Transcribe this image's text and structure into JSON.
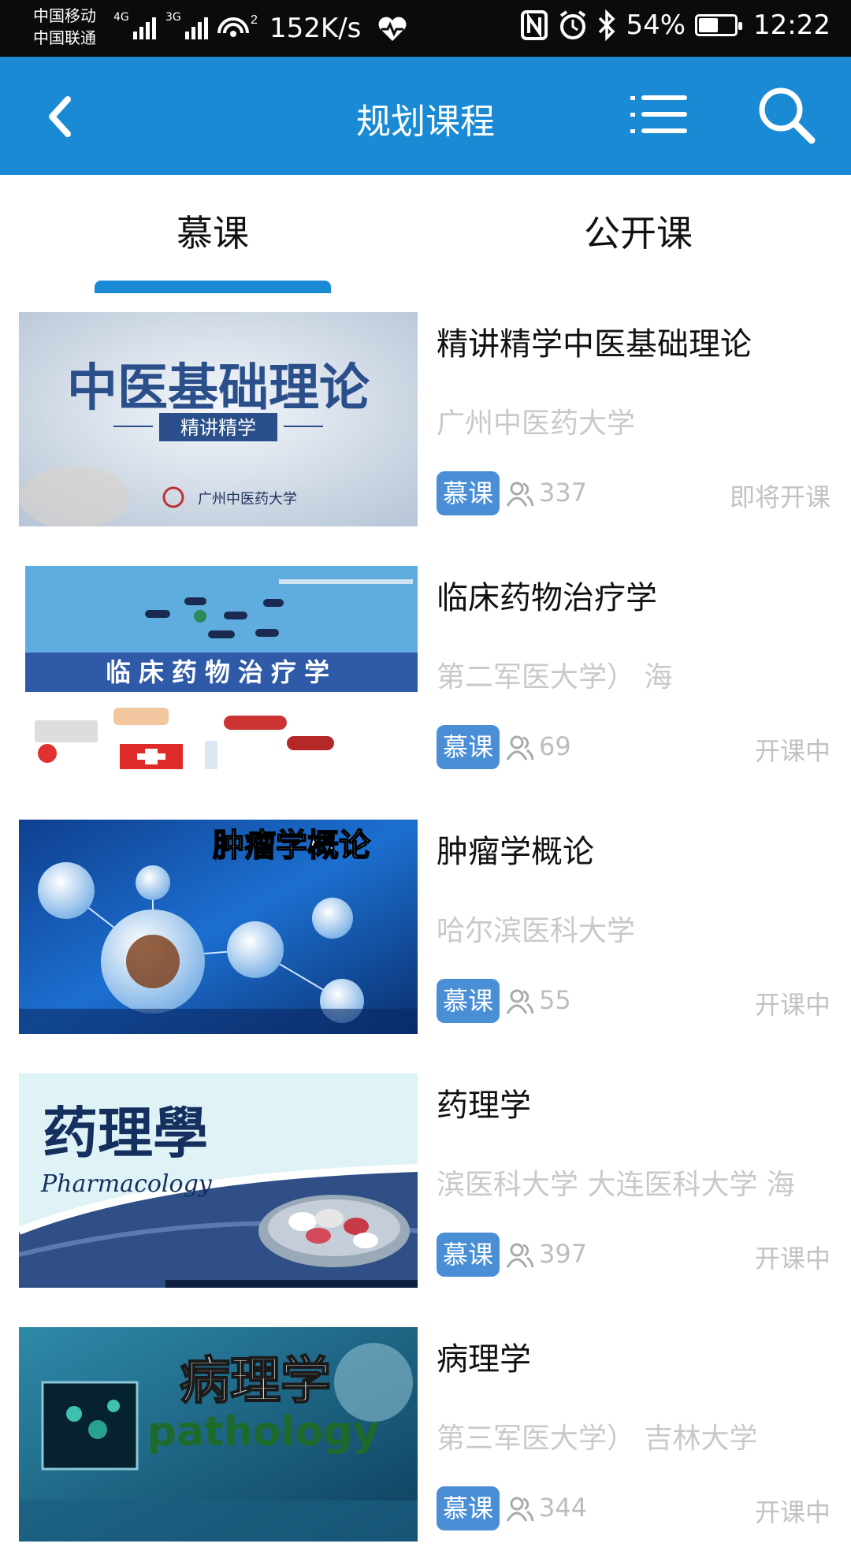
{
  "status_bar": {
    "carrier_1": "中国移动",
    "carrier_2": "中国联通",
    "net_1": "4G",
    "net_2": "3G",
    "hotspot_count": "2",
    "speed": "152K/s",
    "battery_text": "54%",
    "battery_level": 0.54,
    "time": "12:22"
  },
  "navbar": {
    "title": "规划课程",
    "color": "#1a8ad4"
  },
  "tabs": [
    {
      "label": "慕课",
      "selected": true
    },
    {
      "label": "公开课",
      "selected": false
    }
  ],
  "courses": [
    {
      "title": "精讲精学中医基础理论",
      "school": "广州中医药大学",
      "badge": "慕课",
      "count": "337",
      "status": "即将开课",
      "thumb": {
        "main": "中医基础理论",
        "sub": "精讲精学",
        "footer": "广州中医药大学"
      }
    },
    {
      "title": "临床药物治疗学",
      "school": "第二军医大学）          海",
      "badge": "慕课",
      "count": "69",
      "status": "开课中",
      "thumb": {
        "band": "临床药物治疗学"
      }
    },
    {
      "title": "肿瘤学概论",
      "school": "哈尔滨医科大学",
      "badge": "慕课",
      "count": "55",
      "status": "开课中",
      "thumb": {
        "main": "肿瘤学概论"
      }
    },
    {
      "title": "药理学",
      "school": "滨医科大学  大连医科大学  海",
      "badge": "慕课",
      "count": "397",
      "status": "开课中",
      "thumb": {
        "main": "药理學",
        "sub": "Pharmacology"
      }
    },
    {
      "title": "病理学",
      "school": "第三军医大学）  吉林大学",
      "badge": "慕课",
      "count": "344",
      "status": "开课中",
      "thumb": {
        "main": "病理学",
        "sub": "pathology"
      }
    }
  ]
}
